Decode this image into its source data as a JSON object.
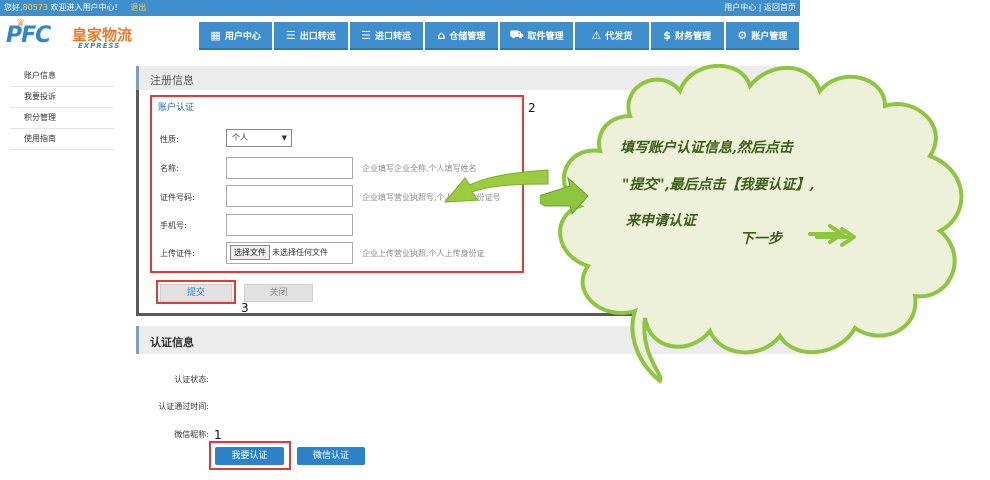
{
  "topbar": {
    "greeting": "您好,",
    "user_id": "80573",
    "welcome": "欢迎进入用户中心!",
    "logout": "退出",
    "right_links": "用户中心 | 返回首页"
  },
  "logo": {
    "brand": "PFC",
    "name_cn": "皇家物流",
    "name_en": "EXPRESS"
  },
  "nav": [
    {
      "label": "用户中心",
      "icon": "grid-icon"
    },
    {
      "label": "出口转运",
      "icon": "list-icon"
    },
    {
      "label": "进口转运",
      "icon": "list-icon"
    },
    {
      "label": "仓储管理",
      "icon": "home-icon"
    },
    {
      "label": "取件管理",
      "icon": "car-icon"
    },
    {
      "label": "代发货",
      "icon": "warning-icon"
    },
    {
      "label": "财务管理",
      "icon": "dollar-icon"
    },
    {
      "label": "账户管理",
      "icon": "gear-icon"
    }
  ],
  "sidebar": {
    "items": [
      {
        "label": "账户信息"
      },
      {
        "label": "我要投诉"
      },
      {
        "label": "积分管理"
      },
      {
        "label": "使用指南"
      }
    ]
  },
  "register": {
    "title": "注册信息",
    "subtitle": "账户认证",
    "gender_label": "性质:",
    "gender_value": "个人",
    "name_label": "名称:",
    "name_hint": "企业填写企业全称,个人填写姓名",
    "id_label": "证件号码:",
    "id_hint": "企业填写营业执照号,个人填写身份证号",
    "phone_label": "手机号:",
    "upload_label": "上传证件:",
    "choose_file": "选择文件",
    "no_file": "未选择任何文件",
    "upload_hint": "企业上传营业执照,个人上传身份证",
    "submit": "提交",
    "close": "关闭"
  },
  "auth": {
    "title": "认证信息",
    "status_label": "认证状态:",
    "pass_time_label": "认证通过时间:",
    "wechat_nick_label": "微信昵称:",
    "my_auth_button": "我要认证",
    "wechat_auth_button": "微信认证"
  },
  "annotations": {
    "step1": "1",
    "step2": "2",
    "step3": "3"
  },
  "callout": {
    "line1": "填写账户认证信息,然后点击",
    "line2": "\"提交\",最后点击【我要认证】,",
    "line3": "来申请认证",
    "next": "下一步",
    "fill_color": "#eef1da",
    "border_color": "#8cc63f"
  }
}
